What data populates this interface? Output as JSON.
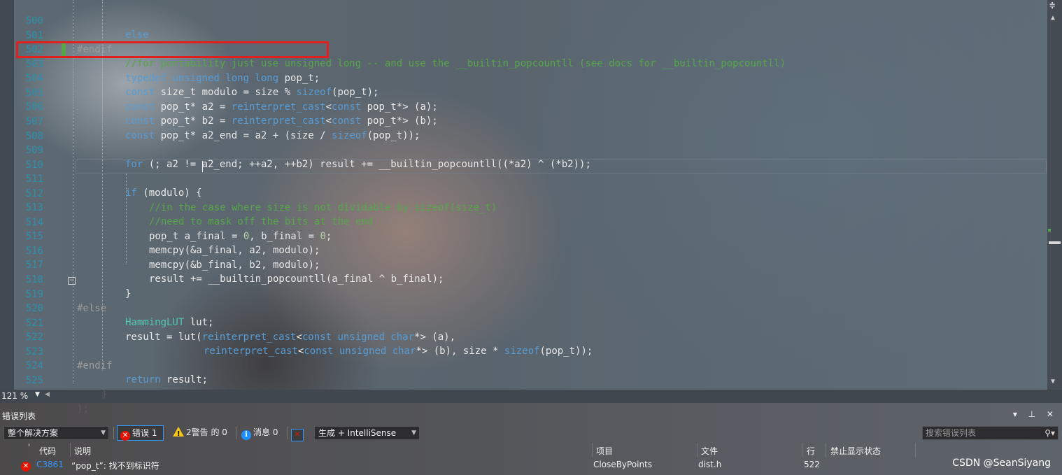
{
  "editor": {
    "zoom": "121 %",
    "lines": [
      {
        "num": "500",
        "top": 0
      },
      {
        "num": "501"
      },
      {
        "num": "502"
      },
      {
        "num": "503"
      },
      {
        "num": "504"
      },
      {
        "num": "505"
      },
      {
        "num": "506"
      },
      {
        "num": "507"
      },
      {
        "num": "508"
      },
      {
        "num": "509"
      },
      {
        "num": "510"
      },
      {
        "num": "511"
      },
      {
        "num": "512"
      },
      {
        "num": "513"
      },
      {
        "num": "514"
      },
      {
        "num": "515"
      },
      {
        "num": "516"
      },
      {
        "num": "517"
      },
      {
        "num": "518"
      },
      {
        "num": "519"
      },
      {
        "num": "520"
      },
      {
        "num": "521"
      },
      {
        "num": "522"
      },
      {
        "num": "523"
      },
      {
        "num": "524"
      },
      {
        "num": "525"
      },
      {
        "num": "526"
      }
    ],
    "code": {
      "l500": "else",
      "l501": "#endif",
      "l502": "//for portability just use unsigned long -- and use the __builtin_popcountll (see docs for __builtin_popcountll)",
      "l503_kw": "typedef unsigned long long",
      "l503_rest": " pop_t;",
      "l504_kw": "const",
      "l504_a": " size_t modulo = size % ",
      "l504_kw2": "sizeof",
      "l504_b": "(pop_t);",
      "l505_kw": "const",
      "l505_a": " pop_t* a2 = ",
      "l505_kw2": "reinterpret_cast",
      "l505_b": "<",
      "l505_kw3": "const",
      "l505_c": " pop_t*> (a);",
      "l506_kw": "const",
      "l506_a": " pop_t* b2 = ",
      "l506_kw2": "reinterpret_cast",
      "l506_b": "<",
      "l506_kw3": "const",
      "l506_c": " pop_t*> (b);",
      "l507_kw": "const",
      "l507_a": " pop_t* a2_end = a2 + (size / ",
      "l507_kw2": "sizeof",
      "l507_b": "(pop_t));",
      "l509_kw": "for",
      "l509_a": " (; a2 != a2_end; ++a2, ++b2) result += __builtin_popcountll((*a2) ^ (*b2));",
      "l511_kw": "if",
      "l511_a": " (modulo) {",
      "l512": "//in the case where size is not dividable by sizeof(size_t)",
      "l513": "//need to mask off the bits at the end",
      "l514_a": "pop_t a_final = ",
      "l514_n1": "0",
      "l514_b": ", b_final = ",
      "l514_n2": "0",
      "l514_c": ";",
      "l515": "memcpy(&a_final, a2, modulo);",
      "l516": "memcpy(&b_final, b2, modulo);",
      "l517": "result += __builtin_popcountll(a_final ^ b_final);",
      "l518": "}",
      "l519": "#else",
      "l520_ty": "HammingLUT",
      "l520_a": " lut;",
      "l521_a": "result = lut(",
      "l521_kw": "reinterpret_cast",
      "l521_b": "<",
      "l521_kw2": "const unsigned char",
      "l521_c": "*> (a),",
      "l522_kw": "reinterpret_cast",
      "l522_b": "<",
      "l522_kw2": "const unsigned char",
      "l522_c": "*> (b), size * ",
      "l522_kw3": "sizeof",
      "l522_d": "(pop_t));",
      "l523": "#endif",
      "l524_kw": "return",
      "l524_a": " result;",
      "l525": "}",
      "l526": "};"
    }
  },
  "error_list": {
    "title": "错误列表",
    "panel_controls": "▾ ⊥ ✕",
    "scope": "整个解决方案",
    "errors_label": "错误 1",
    "warnings_label": "2警告 的 0",
    "messages_label": "消息 0",
    "build_filter": "生成 + IntelliSense",
    "search_placeholder": "搜索错误列表",
    "columns": {
      "code": "代码",
      "description": "说明",
      "project": "项目",
      "file": "文件",
      "line": "行",
      "suppression": "禁止显示状态"
    },
    "rows": [
      {
        "code": "C3861",
        "description": "“pop_t”: 找不到标识符",
        "project": "CloseByPoints",
        "file": "dist.h",
        "line": "522",
        "suppression": ""
      }
    ]
  },
  "watermark": "CSDN @SeanSiyang"
}
